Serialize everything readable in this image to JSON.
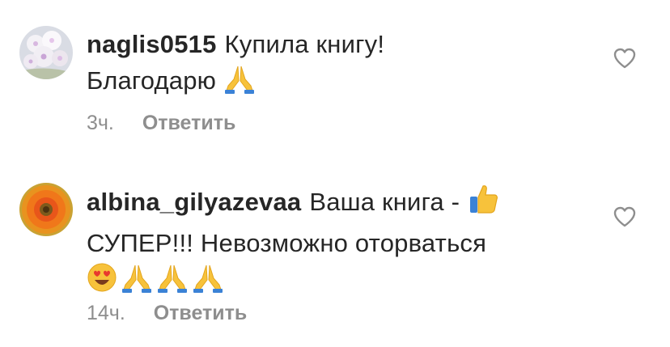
{
  "comments": [
    {
      "username": "naglis0515",
      "lines": [
        "Купила книгу!",
        "Благодарю"
      ],
      "emojis": [
        "folded-hands"
      ],
      "time": "3ч.",
      "reply_label": "Ответить",
      "avatar": "white-flower-bouquet"
    },
    {
      "username": "albina_gilyazevaa",
      "lines": [
        "Ваша книга -",
        "СУПЕР!!! Невозможно оторваться"
      ],
      "emojis": [
        "thumbs-up",
        "heart-eyes",
        "folded-hands",
        "folded-hands",
        "folded-hands"
      ],
      "time": "14ч.",
      "reply_label": "Ответить",
      "avatar": "orange-gerbera"
    }
  ],
  "colors": {
    "text": "#262626",
    "secondary": "#8e8e8e"
  }
}
